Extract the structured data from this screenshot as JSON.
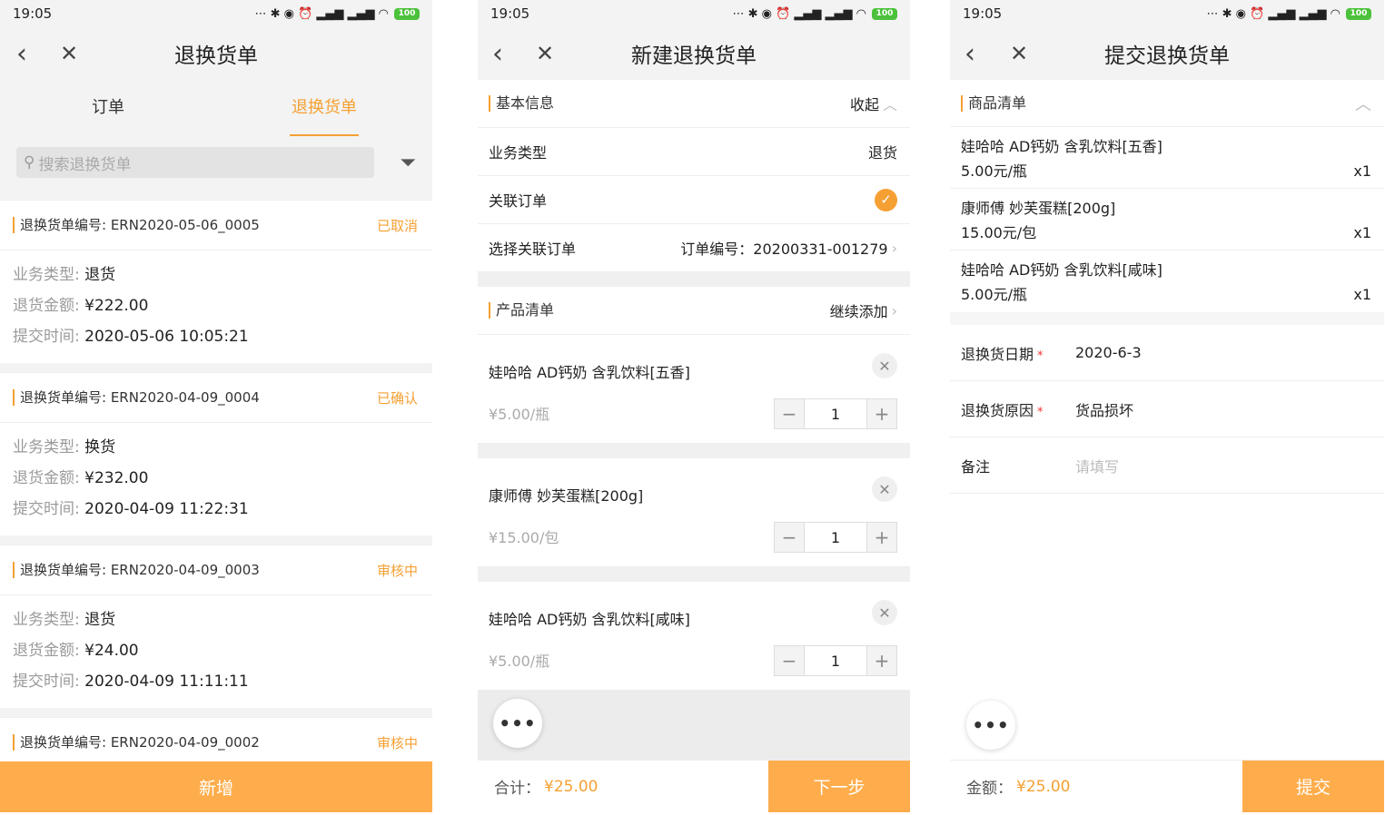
{
  "statusbar": {
    "time": "19:05",
    "battery": "100"
  },
  "screen1": {
    "title": "退换货单",
    "tabs": [
      {
        "label": "订单"
      },
      {
        "label": "退换货单"
      }
    ],
    "search_placeholder": "搜索退换货单",
    "cards": [
      {
        "number": "退换货单编号: ERN2020-05-06_0005",
        "status": "已取消",
        "type_k": "业务类型: ",
        "type_v": "退货",
        "amount_k": "退货金额: ",
        "amount_v": "¥222.00",
        "time_k": "提交时间: ",
        "time_v": "2020-05-06 10:05:21"
      },
      {
        "number": "退换货单编号: ERN2020-04-09_0004",
        "status": "已确认",
        "type_k": "业务类型: ",
        "type_v": "换货",
        "amount_k": "退货金额: ",
        "amount_v": "¥232.00",
        "time_k": "提交时间: ",
        "time_v": "2020-04-09 11:22:31"
      },
      {
        "number": "退换货单编号: ERN2020-04-09_0003",
        "status": "审核中",
        "type_k": "业务类型: ",
        "type_v": "退货",
        "amount_k": "退货金额: ",
        "amount_v": "¥24.00",
        "time_k": "提交时间: ",
        "time_v": "2020-04-09 11:11:11"
      },
      {
        "number": "退换货单编号: ERN2020-04-09_0002",
        "status": "审核中"
      }
    ],
    "add_button": "新增"
  },
  "screen2": {
    "title": "新建退换货单",
    "basic_info": "基本信息",
    "collapse": "收起",
    "biz_type_label": "业务类型",
    "biz_type_value": "退货",
    "link_order_label": "关联订单",
    "select_order_label": "选择关联订单",
    "select_order_value": "订单编号：20200331-001279",
    "product_list": "产品清单",
    "continue_add": "继续添加",
    "products": [
      {
        "name": "娃哈哈 AD钙奶 含乳饮料[五香]",
        "price": "¥5.00/瓶",
        "qty": "1"
      },
      {
        "name": "康师傅 妙芙蛋糕[200g]",
        "price": "¥15.00/包",
        "qty": "1"
      },
      {
        "name": "娃哈哈 AD钙奶 含乳饮料[咸味]",
        "price": "¥5.00/瓶",
        "qty": "1"
      }
    ],
    "total_label": "合计：",
    "total_value": "¥25.00",
    "next_button": "下一步"
  },
  "screen3": {
    "title": "提交退换货单",
    "goods_list": "商品清单",
    "goods": [
      {
        "name": "娃哈哈 AD钙奶 含乳饮料[五香]",
        "price": "5.00元/瓶",
        "qty": "x1"
      },
      {
        "name": "康师傅 妙芙蛋糕[200g]",
        "price": "15.00元/包",
        "qty": "x1"
      },
      {
        "name": "娃哈哈 AD钙奶 含乳饮料[咸味]",
        "price": "5.00元/瓶",
        "qty": "x1"
      }
    ],
    "date_label": "退换货日期",
    "date_value": "2020-6-3",
    "reason_label": "退换货原因",
    "reason_value": "货品损坏",
    "remark_label": "备注",
    "remark_placeholder": "请填写",
    "amount_label": "金额：",
    "amount_value": "¥25.00",
    "submit_button": "提交"
  }
}
